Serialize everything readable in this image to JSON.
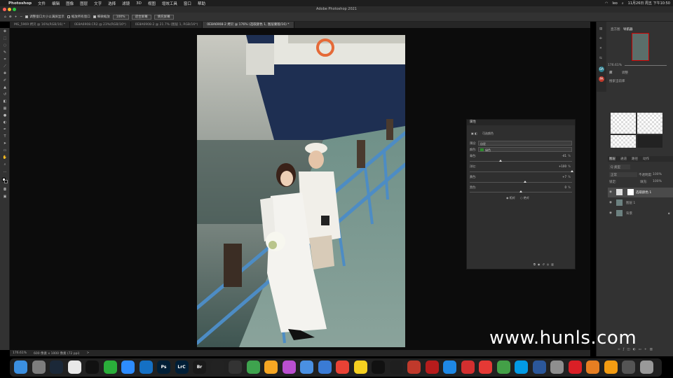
{
  "menubar": {
    "apple": "",
    "items": [
      "Photoshop",
      "文件",
      "编辑",
      "图像",
      "图层",
      "文字",
      "选择",
      "滤镜",
      "3D",
      "视图",
      "增效工具",
      "窗口",
      "帮助"
    ],
    "clock": "11月26日 周五 下午10:50",
    "user": "leo"
  },
  "window": {
    "title": "Adobe Photoshop 2021"
  },
  "options": {
    "resize_label": "调整窗口大小以满屏显示",
    "zoom_all_label": "缩放所有窗口",
    "scrubby_label": "细微缩放",
    "zoom_value": "100%",
    "fit_screen": "适合屏幕",
    "fill_screen": "填充屏幕"
  },
  "tabs": [
    {
      "label": "MG_5969 拷贝 @ 16%(RGB/16) *"
    },
    {
      "label": "0E8A6908.CR2 @ 23%(RGB/16*)"
    },
    {
      "label": "0E8A6908-2 @ 21.7% (图层 1, RGB/16*)"
    },
    {
      "label": "0E8A6908-2 拷贝 @ 176% (选取颜色 1, 图层蒙版/16) *"
    }
  ],
  "status": {
    "zoom": "176.61%",
    "size": "600 像素 x 1000 像素 (72 ppi)",
    "arrow": ">"
  },
  "properties": {
    "title": "属性",
    "subtitle": "可选颜色",
    "preset_label": "预设:",
    "preset_value": "自定",
    "color_label": "颜色:",
    "color_value": "绿色",
    "sliders": [
      {
        "name": "青色:",
        "value": "-41",
        "pos": 0.3
      },
      {
        "name": "洋红:",
        "value": "+100",
        "pos": 1.0
      },
      {
        "name": "黄色:",
        "value": "+7",
        "pos": 0.54
      },
      {
        "name": "黑色:",
        "value": "0",
        "pos": 0.5
      }
    ],
    "relative": "相对",
    "absolute": "绝对"
  },
  "right": {
    "tabs_top": [
      "直方图",
      "导航器"
    ],
    "nav_zoom": "176.61%",
    "tabs_mid": [
      "库",
      "调整"
    ],
    "search_placeholder": "搜索当前库",
    "tabs_layers": [
      "图层",
      "通道",
      "路径",
      "动作"
    ],
    "kind_label": "Q 类型",
    "blend": "正常",
    "opacity_label": "不透明度:",
    "opacity": "100%",
    "lock_label": "锁定:",
    "fill_label": "填充:",
    "fill": "100%",
    "layers": [
      {
        "name": "选取颜色 1"
      },
      {
        "name": "图层 1"
      },
      {
        "name": "背景"
      }
    ]
  },
  "watermark": "www.hunls.com",
  "dock_apps": [
    "Finder",
    "Launchpad",
    "Steam",
    "Chrome",
    "QQ",
    "WeChat",
    "Zoom",
    "Edge",
    "Ps",
    "LrC",
    "Br",
    "1",
    "OBS",
    "Maps",
    "Photos",
    "ColorSync",
    "Mail",
    "Finder2",
    "Chrome2",
    "Notes",
    "FCP",
    "DaVinci",
    "ScreenRecorder",
    "ABC",
    "AppStore",
    "Netease",
    "Weibo",
    "Tools",
    "Telegram",
    "Word",
    "Settings",
    "CC",
    "Paint",
    "Pages",
    "Pic",
    "Trash"
  ]
}
